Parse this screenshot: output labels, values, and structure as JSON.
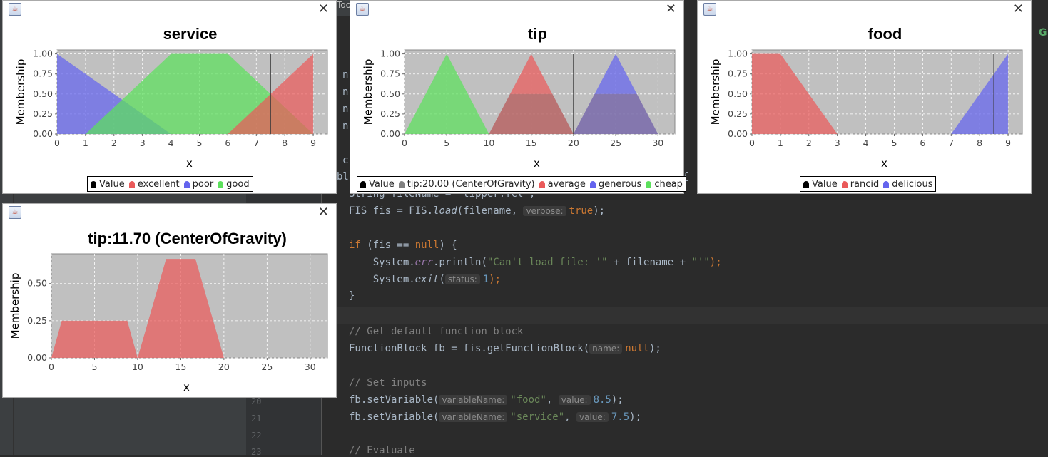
{
  "colors": {
    "red": "#ea5a5a",
    "blue": "#6464ee",
    "green": "#5ce05c",
    "plot_bg": "#c0c0c0",
    "value_marker": "#000000",
    "defuzz_marker": "#808080"
  },
  "icons": {
    "window_icon": "java-icon",
    "close": "close-icon"
  },
  "ide": {
    "gutter_numbers": [
      "20",
      "21",
      "22",
      "23"
    ],
    "fragments": {
      "left_n": "n",
      "left_c": "c",
      "left_bl": "bl",
      "brace": "{",
      "toolbar_frag": "Too"
    },
    "code": {
      "line_filename": "String fileName = \"tipper.fcl\";",
      "fis_decl": "FIS fis = FIS.",
      "fis_load": "load",
      "fis_args": "(filename, ",
      "hint_verbose": "verbose:",
      "val_true": "true",
      "close_paren_semi": ");",
      "if_kw": "if",
      "if_cond": " (fis == ",
      "null_kw": "null",
      "if_open": ") {",
      "sys_prefix": "    System.",
      "err_field": "err",
      "println_part": ".println(",
      "str_cant_load": "\"Can't load file: '\"",
      "plus_filename": " + filename + ",
      "str_quote": "\"'\"",
      "exit_fn": "exit",
      "hint_status": "status:",
      "val_1": "1",
      "close_brace": "}",
      "comment_default": "// Get default function block",
      "fb_decl": "FunctionBlock fb = fis.getFunctionBlock(",
      "hint_name": "name:",
      "comment_inputs": "// Set inputs",
      "set_var": "fb.setVariable(",
      "hint_varname": "variableName:",
      "str_food": "\"food\"",
      "comma": ", ",
      "hint_value": "value:",
      "val_85": "8.5",
      "str_service": "\"service\"",
      "val_75": "7.5",
      "comment_evaluate": "// Evaluate"
    }
  },
  "windows": [
    {
      "key": "service",
      "chart_data": {
        "type": "area",
        "title": "service",
        "xlabel": "x",
        "ylabel": "Membership",
        "xlim": [
          0,
          9.5
        ],
        "ylim": [
          0,
          1.05
        ],
        "xticks": [
          0,
          1,
          2,
          3,
          4,
          5,
          6,
          7,
          8,
          9
        ],
        "yticks": [
          "0.00",
          "0.25",
          "0.50",
          "0.75",
          "1.00"
        ],
        "grid": true,
        "series": [
          {
            "name": "poor",
            "color": "blue",
            "x": [
              0,
              0,
              4
            ],
            "y": [
              0,
              1,
              0
            ]
          },
          {
            "name": "good",
            "color": "green",
            "x": [
              1,
              4,
              6,
              9
            ],
            "y": [
              0,
              1,
              1,
              0
            ]
          },
          {
            "name": "excellent",
            "color": "red",
            "x": [
              6,
              9,
              9
            ],
            "y": [
              0,
              1,
              0
            ]
          }
        ],
        "value_marker": 7.5,
        "legend": [
          {
            "label": "Value",
            "color": "value_marker"
          },
          {
            "label": "excellent",
            "color": "red"
          },
          {
            "label": "poor",
            "color": "blue"
          },
          {
            "label": "good",
            "color": "green"
          }
        ]
      }
    },
    {
      "key": "tip",
      "chart_data": {
        "type": "area",
        "title": "tip",
        "xlabel": "x",
        "ylabel": "Membership",
        "xlim": [
          0,
          32
        ],
        "ylim": [
          0,
          1.05
        ],
        "xticks": [
          0,
          5,
          10,
          15,
          20,
          25,
          30
        ],
        "yticks": [
          "0.00",
          "0.25",
          "0.50",
          "0.75",
          "1.00"
        ],
        "grid": true,
        "series": [
          {
            "name": "cheap",
            "color": "green",
            "x": [
              0,
              5,
              10
            ],
            "y": [
              0,
              1,
              0
            ]
          },
          {
            "name": "average",
            "color": "red",
            "x": [
              10,
              15,
              20
            ],
            "y": [
              0,
              1,
              0
            ]
          },
          {
            "name": "generous",
            "color": "blue",
            "x": [
              20,
              25,
              30
            ],
            "y": [
              0,
              1,
              0
            ]
          }
        ],
        "value_marker": 20,
        "activation_level": 0.5,
        "legend": [
          {
            "label": "Value",
            "color": "value_marker"
          },
          {
            "label": "tip:20.00 (CenterOfGravity)",
            "color": "defuzz_marker"
          },
          {
            "label": "average",
            "color": "red"
          },
          {
            "label": "generous",
            "color": "blue"
          },
          {
            "label": "cheap",
            "color": "green"
          }
        ]
      }
    },
    {
      "key": "food",
      "chart_data": {
        "type": "area",
        "title": "food",
        "xlabel": "x",
        "ylabel": "Membership",
        "xlim": [
          0,
          9.5
        ],
        "ylim": [
          0,
          1.05
        ],
        "xticks": [
          0,
          1,
          2,
          3,
          4,
          5,
          6,
          7,
          8,
          9
        ],
        "yticks": [
          "0.00",
          "0.25",
          "0.50",
          "0.75",
          "1.00"
        ],
        "grid": true,
        "series": [
          {
            "name": "rancid",
            "color": "red",
            "x": [
              0,
              0,
              1,
              3
            ],
            "y": [
              0,
              1,
              1,
              0
            ]
          },
          {
            "name": "delicious",
            "color": "blue",
            "x": [
              7,
              9,
              9
            ],
            "y": [
              0,
              1,
              0
            ]
          }
        ],
        "value_marker": 8.5,
        "legend": [
          {
            "label": "Value",
            "color": "value_marker"
          },
          {
            "label": "rancid",
            "color": "red"
          },
          {
            "label": "delicious",
            "color": "blue"
          }
        ]
      }
    },
    {
      "key": "tip_result",
      "chart_data": {
        "type": "area",
        "title": "tip:11.70 (CenterOfGravity)",
        "xlabel": "x",
        "ylabel": "Membership",
        "xlim": [
          0,
          32
        ],
        "ylim": [
          0,
          0.7
        ],
        "xticks": [
          0,
          5,
          10,
          15,
          20,
          25,
          30
        ],
        "yticks": [
          "0.00",
          "0.25",
          "0.50"
        ],
        "ytick_values": [
          0,
          0.25,
          0.5
        ],
        "grid": true,
        "series": [
          {
            "name": "",
            "color": "red",
            "x": [
              0,
              1.2,
              8.8,
              10,
              10,
              13.3,
              16.7,
              20
            ],
            "y": [
              0,
              0.25,
              0.25,
              0,
              0,
              0.666,
              0.666,
              0
            ]
          }
        ]
      }
    }
  ]
}
